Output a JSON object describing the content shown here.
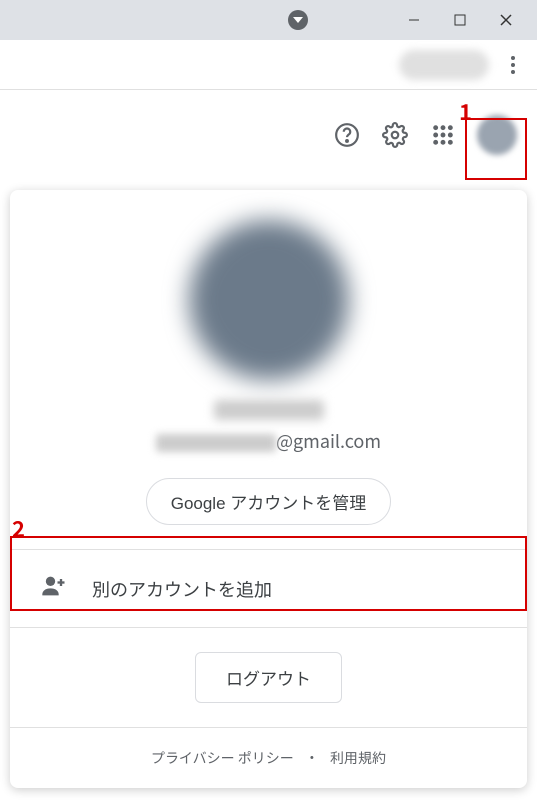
{
  "window": {
    "minimize": "−",
    "maximize": "▢",
    "close": "×"
  },
  "annotations": {
    "one": "1",
    "two": "2"
  },
  "account": {
    "email_domain": "@gmail.com",
    "manage_label": "Google アカウントを管理",
    "add_account_label": "別のアカウントを追加",
    "logout_label": "ログアウト"
  },
  "footer": {
    "privacy": "プライバシー ポリシー",
    "separator": "・",
    "terms": "利用規約"
  }
}
